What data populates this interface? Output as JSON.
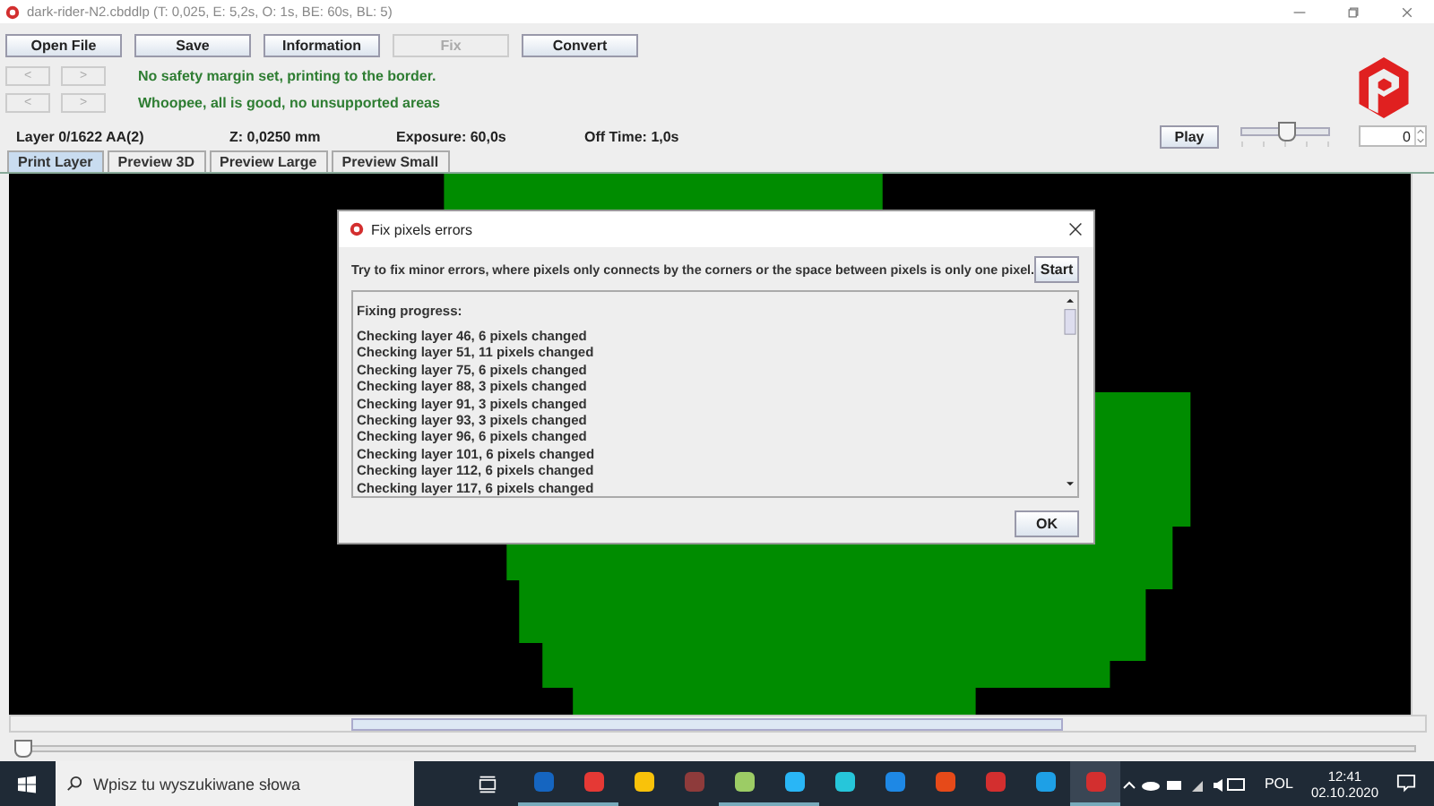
{
  "window": {
    "title": "dark-rider-N2.cbddlp (T: 0,025, E: 5,2s, O: 1s, BE: 60s, BL: 5)"
  },
  "toolbar": [
    {
      "label": "Open File",
      "disabled": false
    },
    {
      "label": "Save",
      "disabled": false
    },
    {
      "label": "Information",
      "disabled": false
    },
    {
      "label": "Fix",
      "disabled": true
    },
    {
      "label": "Convert",
      "disabled": false
    }
  ],
  "messages": [
    {
      "prev": "<",
      "next": ">",
      "text": "No safety margin set, printing to the border."
    },
    {
      "prev": "<",
      "next": ">",
      "text": "Whoopee, all is good, no unsupported areas"
    }
  ],
  "info": {
    "layer": "Layer 0/1622 AA(2)",
    "z": "Z: 0,0250 mm",
    "exposure": "Exposure: 60,0s",
    "off_time": "Off Time: 1,0s"
  },
  "playback": {
    "button": "Play",
    "speed_slider": {
      "level": 0.5
    },
    "frame": "0"
  },
  "tabs": [
    {
      "label": "Print Layer",
      "selected": true
    },
    {
      "label": "Preview 3D",
      "selected": false
    },
    {
      "label": "Preview Large",
      "selected": false
    },
    {
      "label": "Preview Small",
      "selected": false
    }
  ],
  "layer_slider": {
    "level": 0
  },
  "dialog": {
    "title": "Fix pixels errors",
    "description": "Try to fix minor errors, where pixels only connects by the corners or the space between pixels is only one pixel.",
    "start_button": "Start",
    "log_heading": "Fixing progress:",
    "log": [
      "Checking layer 46, 6 pixels changed",
      "Checking layer 51, 11 pixels changed",
      "Checking layer 75, 6 pixels changed",
      "Checking layer 88, 3 pixels changed",
      "Checking layer 91, 3 pixels changed",
      "Checking layer 93, 3 pixels changed",
      "Checking layer 96, 6 pixels changed",
      "Checking layer 101, 6 pixels changed",
      "Checking layer 112, 6 pixels changed",
      "Checking layer 117, 6 pixels changed"
    ],
    "ok_button": "OK"
  },
  "taskbar": {
    "search": {
      "placeholder": "Wpisz tu wyszukiwane słowa"
    },
    "apps": [
      {
        "kind": "mail",
        "running": true,
        "selected": false
      },
      {
        "kind": "browser",
        "running": true,
        "selected": false
      },
      {
        "kind": "folder",
        "running": false,
        "selected": false
      },
      {
        "kind": "ball",
        "running": false,
        "selected": false
      },
      {
        "kind": "paint",
        "running": true,
        "selected": false
      },
      {
        "kind": "wave",
        "running": true,
        "selected": false
      },
      {
        "kind": "bracket",
        "running": false,
        "selected": false
      },
      {
        "kind": "window",
        "running": false,
        "selected": false
      },
      {
        "kind": "office",
        "running": false,
        "selected": false
      },
      {
        "kind": "pin",
        "running": false,
        "selected": false
      },
      {
        "kind": "cloud",
        "running": false,
        "selected": false
      },
      {
        "kind": "pin",
        "running": true,
        "selected": true
      }
    ],
    "language": "POL",
    "time": "12:41",
    "date": "02.10.2020"
  }
}
